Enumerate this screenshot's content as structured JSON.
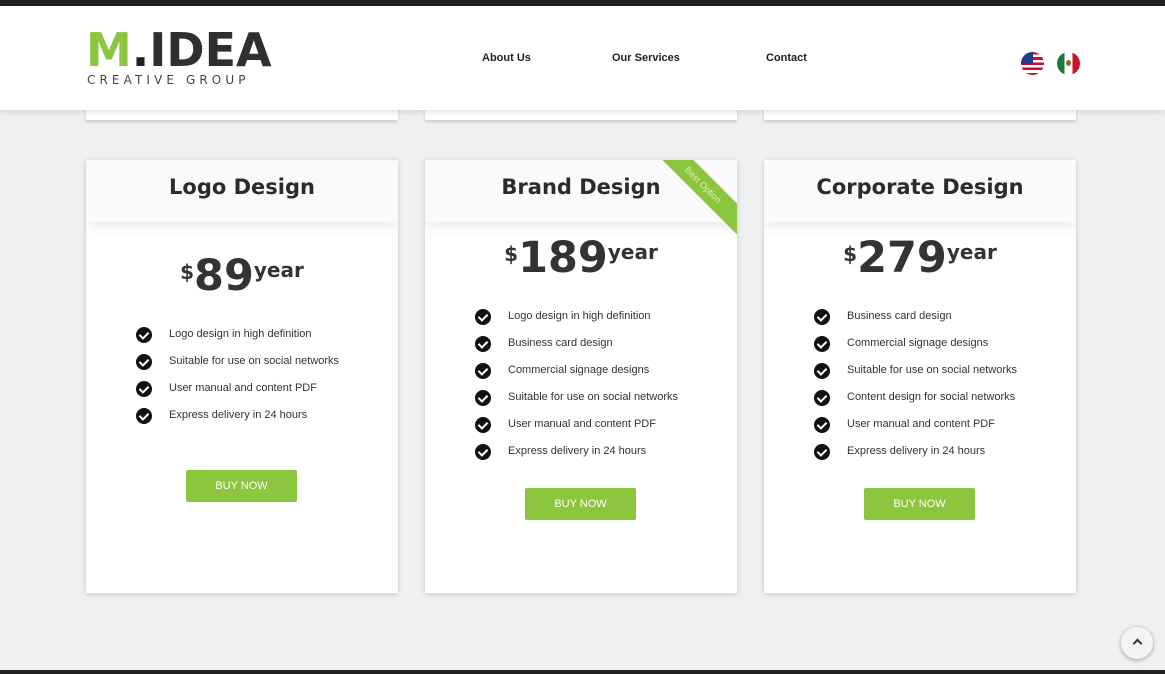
{
  "brand": {
    "logo_main_m": "M",
    "logo_main_dot": ".",
    "logo_main_idea": "IDEA",
    "logo_sub": "CREATIVE GROUP"
  },
  "nav": {
    "about": "About Us",
    "services": "Our Services",
    "contact": "Contact"
  },
  "languages": [
    {
      "icon": "us-flag-icon"
    },
    {
      "icon": "mexico-flag-icon"
    }
  ],
  "plans": [
    {
      "title": "Logo Design",
      "currency": "$",
      "price": "89",
      "period": "year",
      "features": [
        "Logo design in high definition",
        "Suitable for use on social networks",
        "User manual and content PDF",
        "Express delivery in 24 hours"
      ],
      "button": "BUY NOW"
    },
    {
      "title": "Brand Design",
      "currency": "$",
      "price": "189",
      "period": "year",
      "ribbon": "Best Option",
      "features": [
        "Logo design in high definition",
        "Business card design",
        "Commercial signage designs",
        "Suitable for use on social networks",
        "User manual and content PDF",
        "Express delivery in 24 hours"
      ],
      "button": "BUY NOW"
    },
    {
      "title": "Corporate Design",
      "currency": "$",
      "price": "279",
      "period": "year",
      "features": [
        "Business card design",
        "Commercial signage designs",
        "Suitable for use on social networks",
        "Content design for social networks",
        "User manual and content PDF",
        "Express delivery in 24 hours"
      ],
      "button": "BUY NOW"
    }
  ],
  "colors": {
    "accent": "#8cc63f",
    "dark": "#222222"
  }
}
